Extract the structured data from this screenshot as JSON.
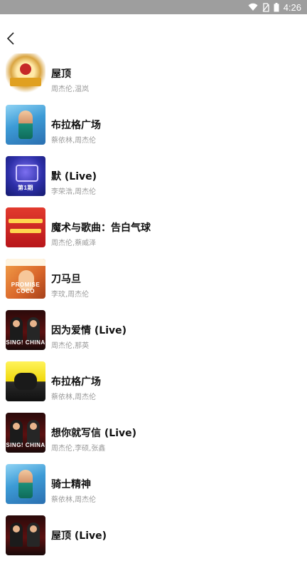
{
  "status_bar": {
    "time": "4:26"
  },
  "songs": [
    {
      "title": "屋顶",
      "artist": "周杰伦,温岚",
      "art": "wedding",
      "badge": ""
    },
    {
      "title": "布拉格广场",
      "artist": "蔡依林,周杰伦",
      "art": "blue",
      "badge": ""
    },
    {
      "title": "默 (Live)",
      "artist": "李荣浩,周杰伦",
      "art": "purple",
      "badge": "第1期"
    },
    {
      "title": "魔术与歌曲：告白气球",
      "artist": "周杰伦,蔡威泽",
      "art": "red",
      "badge": ""
    },
    {
      "title": "刀马旦",
      "artist": "李玟,周杰伦",
      "art": "orange",
      "badge": "PROMISE COCO"
    },
    {
      "title": "因为爱情 (Live)",
      "artist": "周杰伦,那英",
      "art": "dark",
      "badge": "SING! CHINA"
    },
    {
      "title": "布拉格广场",
      "artist": "蔡依林,周杰伦",
      "art": "yellow",
      "badge": ""
    },
    {
      "title": "想你就写信 (Live)",
      "artist": "周杰伦,李硕,张鑫",
      "art": "dark",
      "badge": "SING! CHINA"
    },
    {
      "title": "骑士精神",
      "artist": "蔡依林,周杰伦",
      "art": "blue",
      "badge": ""
    },
    {
      "title": "屋顶 (Live)",
      "artist": "",
      "art": "dark",
      "badge": ""
    }
  ]
}
